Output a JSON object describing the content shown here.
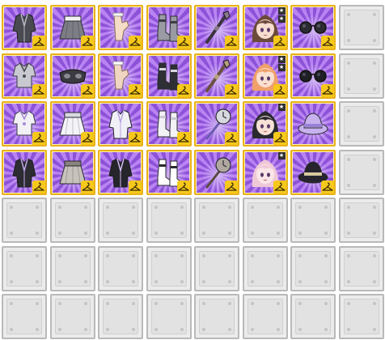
{
  "colors": {
    "frame": "#e9b21a",
    "ray_dark": "#8d52d8",
    "ray_light": "#b984f2",
    "tag": "#f5c81b",
    "empty_bg": "#ebebeb",
    "empty_border": "#b9b9b9"
  },
  "inventory": {
    "columns": 8,
    "rows": 7,
    "rows_data": [
      [
        {
          "name": "inventory-slot-dark-jacket",
          "icon": "dark-jacket-icon",
          "art": "jacket",
          "col": "#4a4a52",
          "acc": "#b9b9c4",
          "tag": true
        },
        {
          "name": "inventory-slot-grey-skirt",
          "icon": "grey-skirt-icon",
          "art": "skirt",
          "col": "#7d7d86",
          "acc": "#f2f2f2",
          "tag": true
        },
        {
          "name": "inventory-slot-cream-gloves",
          "icon": "cream-gloves-icon",
          "art": "gloves",
          "col": "#f4dcc6",
          "acc": "#f2f2f2",
          "tag": true
        },
        {
          "name": "inventory-slot-grey-boots",
          "icon": "grey-boots-icon",
          "art": "boots",
          "col": "#9a9aa4",
          "acc": "#3a3a40",
          "tag": true
        },
        {
          "name": "inventory-slot-dark-staff",
          "icon": "dark-staff-icon",
          "art": "staff",
          "col": "#3b3440",
          "acc": "#8a7a8f",
          "tag": true
        },
        {
          "name": "inventory-slot-avatar-twintail",
          "icon": "twintail-avatar-icon",
          "art": "avatar",
          "col": "#6b4a3a",
          "acc": "#f7ddd0",
          "tag": true,
          "stars": 2
        },
        {
          "name": "inventory-slot-round-glasses",
          "icon": "round-glasses-icon",
          "art": "glasses",
          "col": "#2b2b32",
          "acc": "#5a5a66",
          "tag": true
        },
        {
          "empty": true
        }
      ],
      [
        {
          "name": "inventory-slot-silver-top",
          "icon": "silver-top-icon",
          "art": "top",
          "col": "#c9c9d2",
          "acc": "#4a4a52",
          "tag": true
        },
        {
          "name": "inventory-slot-dark-mask",
          "icon": "dark-mask-icon",
          "art": "mask",
          "col": "#3a3a40",
          "acc": "#8a8a93",
          "tag": true
        },
        {
          "name": "inventory-slot-pale-arm",
          "icon": "pale-arm-icon",
          "art": "gloves",
          "col": "#f0d6c2",
          "acc": "#ffffff",
          "tag": true
        },
        {
          "name": "inventory-slot-dark-sandals",
          "icon": "dark-sandals-icon",
          "art": "boots",
          "col": "#2f2f36",
          "acc": "#d8d8de",
          "tag": true
        },
        {
          "name": "inventory-slot-brown-staff",
          "icon": "brown-staff-icon",
          "art": "staff",
          "col": "#6a5040",
          "acc": "#b9a080",
          "tag": true
        },
        {
          "name": "inventory-slot-avatar-orange",
          "icon": "orange-hair-avatar-icon",
          "art": "avatar",
          "col": "#f0a06a",
          "acc": "#fae0d0",
          "tag": true,
          "stars": 2
        },
        {
          "name": "inventory-slot-dark-glasses",
          "icon": "dark-glasses-icon",
          "art": "glasses",
          "col": "#1f1f26",
          "acc": "#4a4a58",
          "tag": true
        },
        {
          "empty": true
        }
      ],
      [
        {
          "name": "inventory-slot-white-shirt",
          "icon": "white-shirt-icon",
          "art": "top",
          "col": "#f2f2f6",
          "acc": "#a68cd8",
          "tag": true
        },
        {
          "name": "inventory-slot-white-skirt",
          "icon": "white-skirt-icon",
          "art": "skirt",
          "col": "#f4f4f8",
          "acc": "#d8d8e0",
          "tag": true
        },
        {
          "name": "inventory-slot-white-outfit",
          "icon": "white-outfit-icon",
          "art": "jacket",
          "col": "#f0f0f6",
          "acc": "#b8a4e0",
          "tag": true
        },
        {
          "name": "inventory-slot-white-boots",
          "icon": "white-boots-icon",
          "art": "boots",
          "col": "#f2f2f6",
          "acc": "#c8c8d0",
          "tag": true
        },
        {
          "name": "inventory-slot-clock-wand",
          "icon": "clock-wand-icon",
          "art": "clock",
          "col": "#d8d8e0",
          "acc": "#6a5cb0",
          "tag": true
        },
        {
          "name": "inventory-slot-avatar-black-hair",
          "icon": "black-hair-avatar-icon",
          "art": "avatar",
          "col": "#2a2a30",
          "acc": "#f7e0d6",
          "tag": true,
          "stars": 1
        },
        {
          "name": "inventory-slot-lavender-hat",
          "icon": "lavender-hat-icon",
          "art": "hat",
          "col": "#c7b2ee",
          "acc": "#9b80d8",
          "tag": false
        },
        {
          "empty": true
        }
      ],
      [
        {
          "name": "inventory-slot-black-suit",
          "icon": "black-suit-icon",
          "art": "jacket",
          "col": "#2c2c32",
          "acc": "#c0a8e8",
          "tag": true
        },
        {
          "name": "inventory-slot-beige-skirt",
          "icon": "beige-skirt-icon",
          "art": "skirt",
          "col": "#c8c2bc",
          "acc": "#8a847e",
          "tag": true
        },
        {
          "name": "inventory-slot-black-outfit",
          "icon": "black-outfit-icon",
          "art": "jacket",
          "col": "#25252b",
          "acc": "#d0b8f0",
          "tag": true
        },
        {
          "name": "inventory-slot-white-socks",
          "icon": "white-socks-icon",
          "art": "boots",
          "col": "#ffffff",
          "acc": "#2a2a30",
          "tag": true
        },
        {
          "name": "inventory-slot-clock-staff",
          "icon": "clock-staff-icon",
          "art": "clock",
          "col": "#b0a8a0",
          "acc": "#5a4a40",
          "tag": true
        },
        {
          "name": "inventory-slot-avatar-pink-hair",
          "icon": "pink-hair-avatar-icon",
          "art": "avatar",
          "col": "#efc8d8",
          "acc": "#fae6e8",
          "tag": true,
          "stars": 1
        },
        {
          "name": "inventory-slot-black-hat",
          "icon": "black-hat-icon",
          "art": "hat",
          "col": "#28242e",
          "acc": "#d8c8a0",
          "tag": true
        },
        {
          "empty": true
        }
      ],
      [
        {
          "empty": true
        },
        {
          "empty": true
        },
        {
          "empty": true
        },
        {
          "empty": true
        },
        {
          "empty": true
        },
        {
          "empty": true
        },
        {
          "empty": true
        },
        {
          "empty": true
        }
      ],
      [
        {
          "empty": true
        },
        {
          "empty": true
        },
        {
          "empty": true
        },
        {
          "empty": true
        },
        {
          "empty": true
        },
        {
          "empty": true
        },
        {
          "empty": true
        },
        {
          "empty": true
        }
      ],
      [
        {
          "empty": true
        },
        {
          "empty": true
        },
        {
          "empty": true
        },
        {
          "empty": true
        },
        {
          "empty": true
        },
        {
          "empty": true
        },
        {
          "empty": true
        },
        {
          "empty": true
        }
      ]
    ]
  }
}
